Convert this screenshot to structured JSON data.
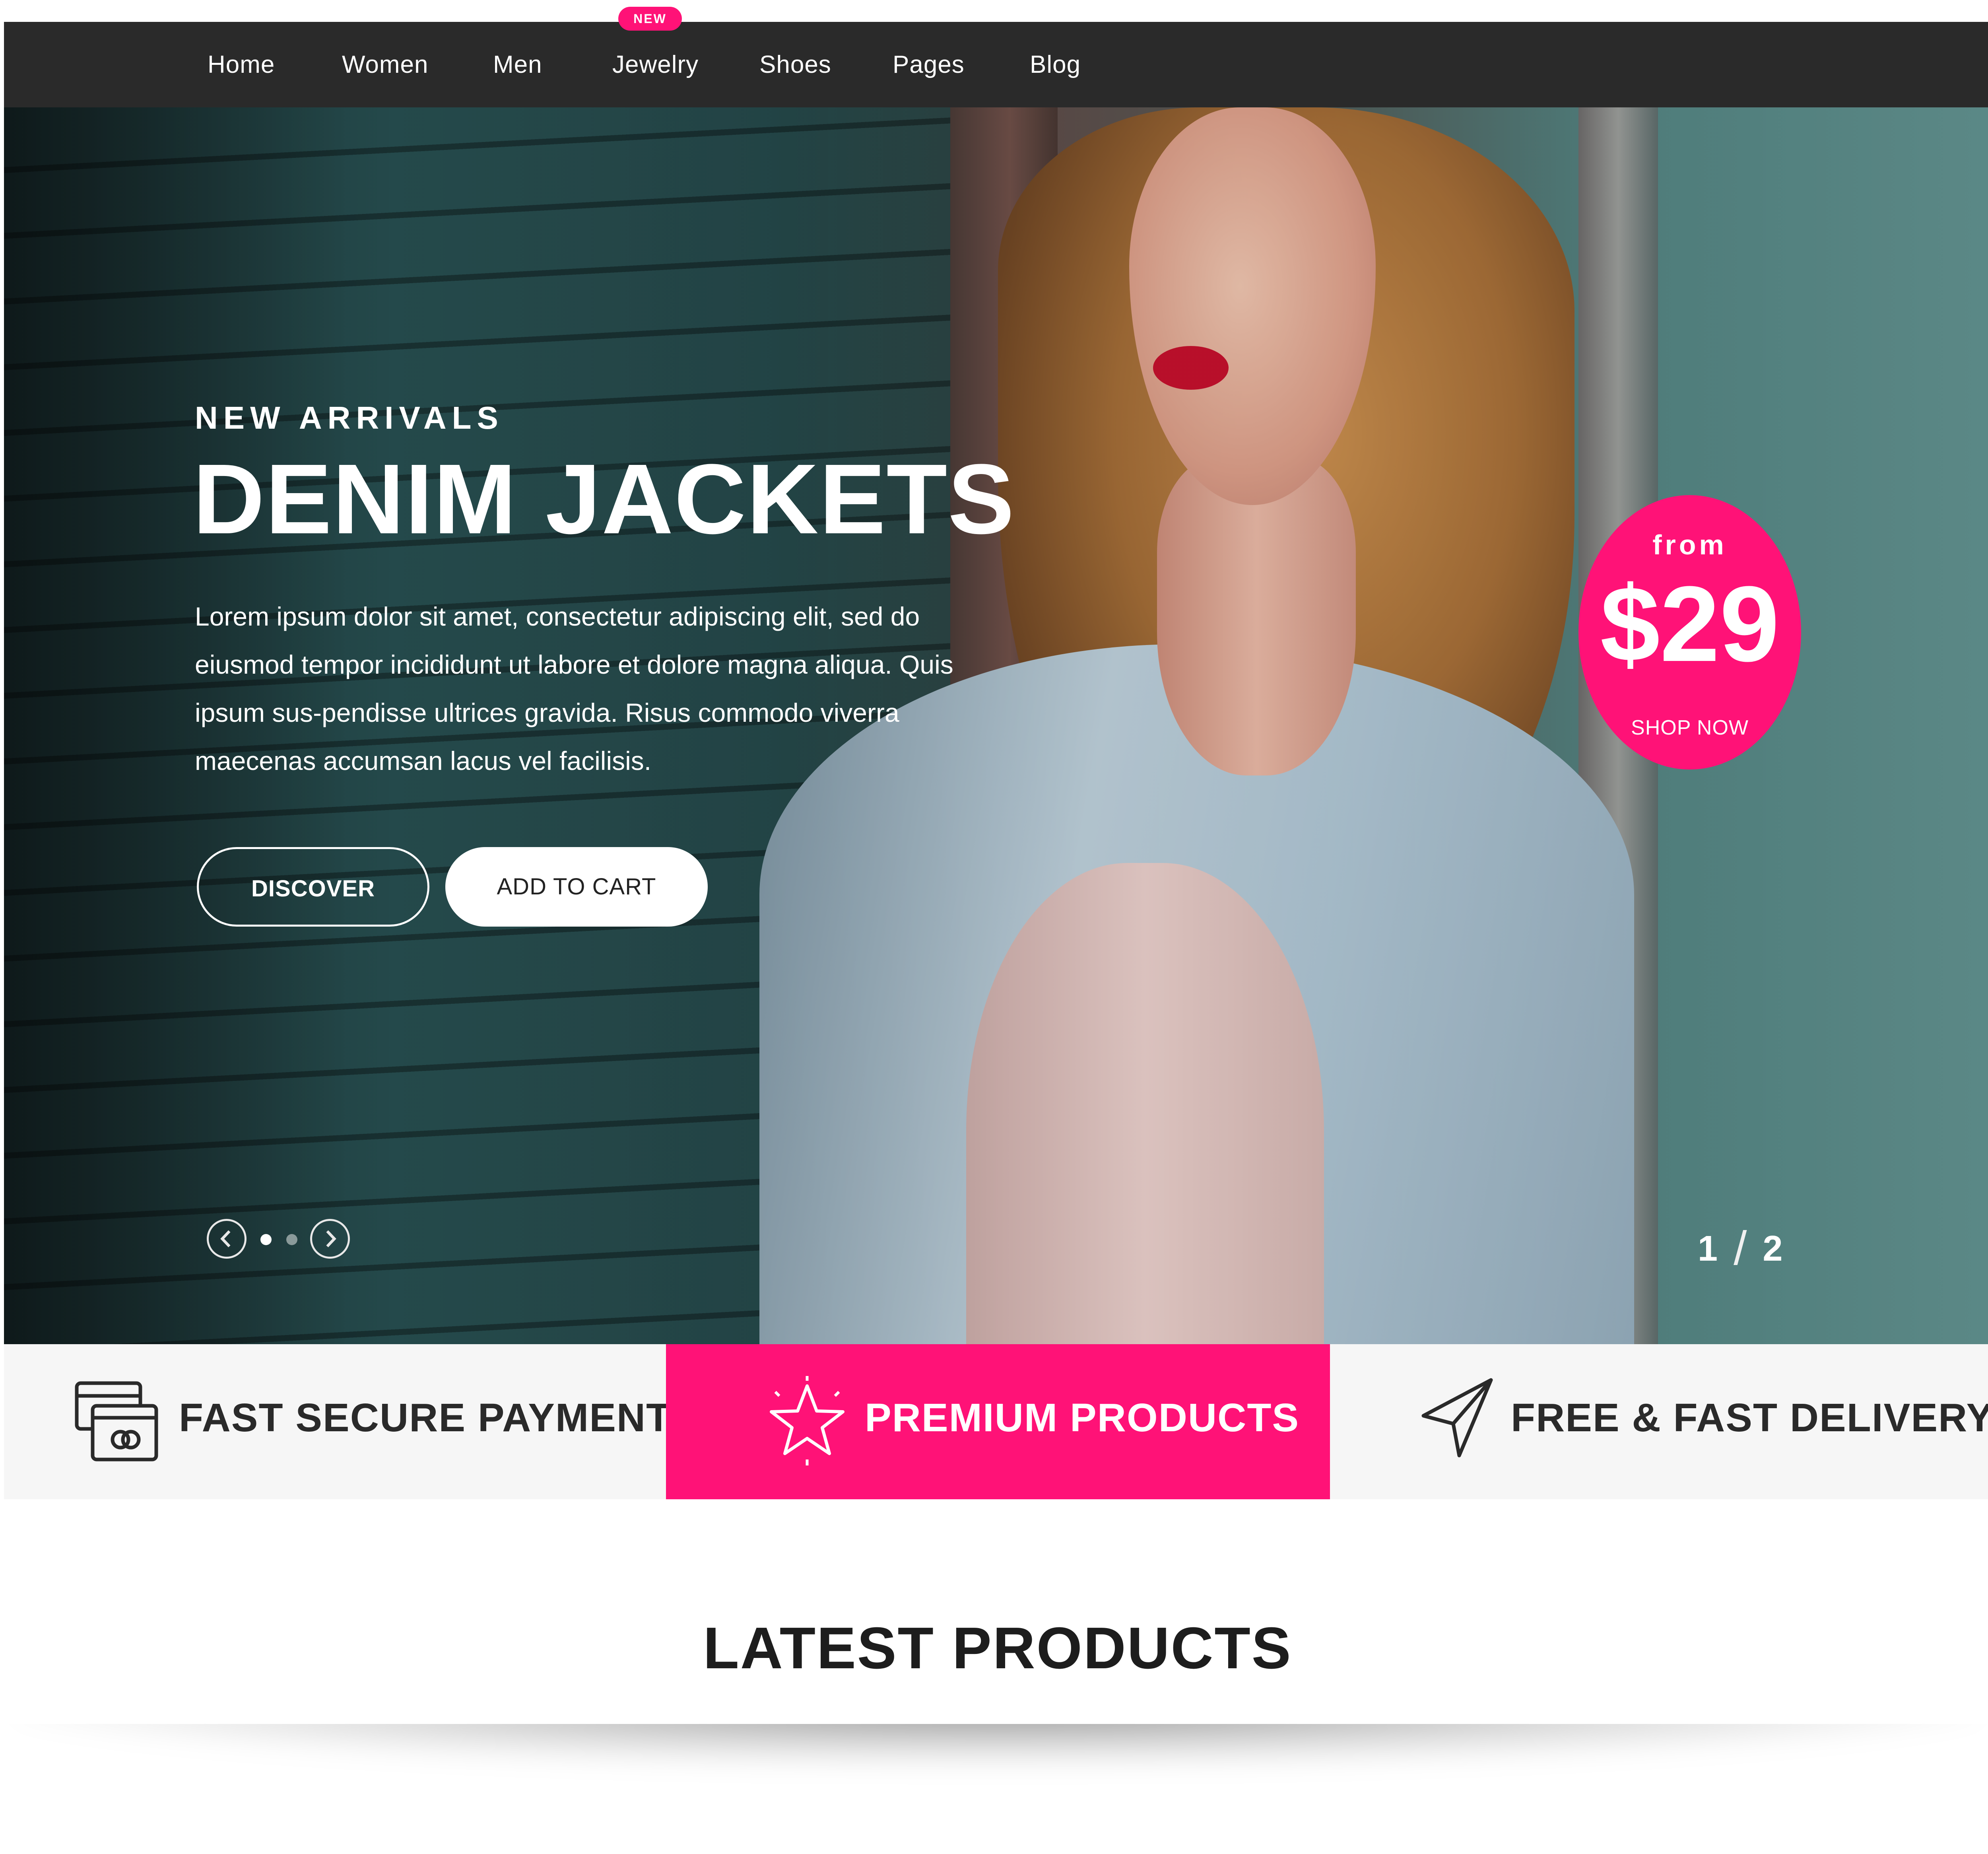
{
  "nav": {
    "items": [
      {
        "label": "Home"
      },
      {
        "label": "Women"
      },
      {
        "label": "Men"
      },
      {
        "label": "Jewelry",
        "badge": "NEW"
      },
      {
        "label": "Shoes"
      },
      {
        "label": "Pages"
      },
      {
        "label": "Blog"
      }
    ]
  },
  "hero": {
    "eyebrow": "NEW ARRIVALS",
    "title": "DENIM JACKETS",
    "description": "Lorem ipsum dolor sit amet, consectetur adipiscing elit, sed do eiusmod tempor incididunt ut labore et dolore magna aliqua. Quis ipsum sus-pendisse ultrices gravida. Risus commodo viverra maecenas accumsan lacus vel facilisis.",
    "discover_label": "DISCOVER",
    "add_to_cart_label": "ADD TO CART",
    "price_badge": {
      "from": "from",
      "price": "$29",
      "cta": "SHOP NOW"
    },
    "slide_current": "1",
    "slide_total": "2",
    "slider_icons": {
      "prev": "chevron-left-icon",
      "next": "chevron-right-icon"
    }
  },
  "features": [
    {
      "label": "FAST SECURE PAYMENTS",
      "icon": "credit-card-icon"
    },
    {
      "label": "PREMIUM PRODUCTS",
      "icon": "star-icon",
      "highlighted": true
    },
    {
      "label": "FREE & FAST DELIVERY",
      "icon": "paper-plane-icon"
    }
  ],
  "latest": {
    "title": "LATEST PRODUCTS"
  },
  "colors": {
    "accent": "#ff1277",
    "nav_bg": "#2a2a2a",
    "features_bg": "#f6f6f6"
  }
}
